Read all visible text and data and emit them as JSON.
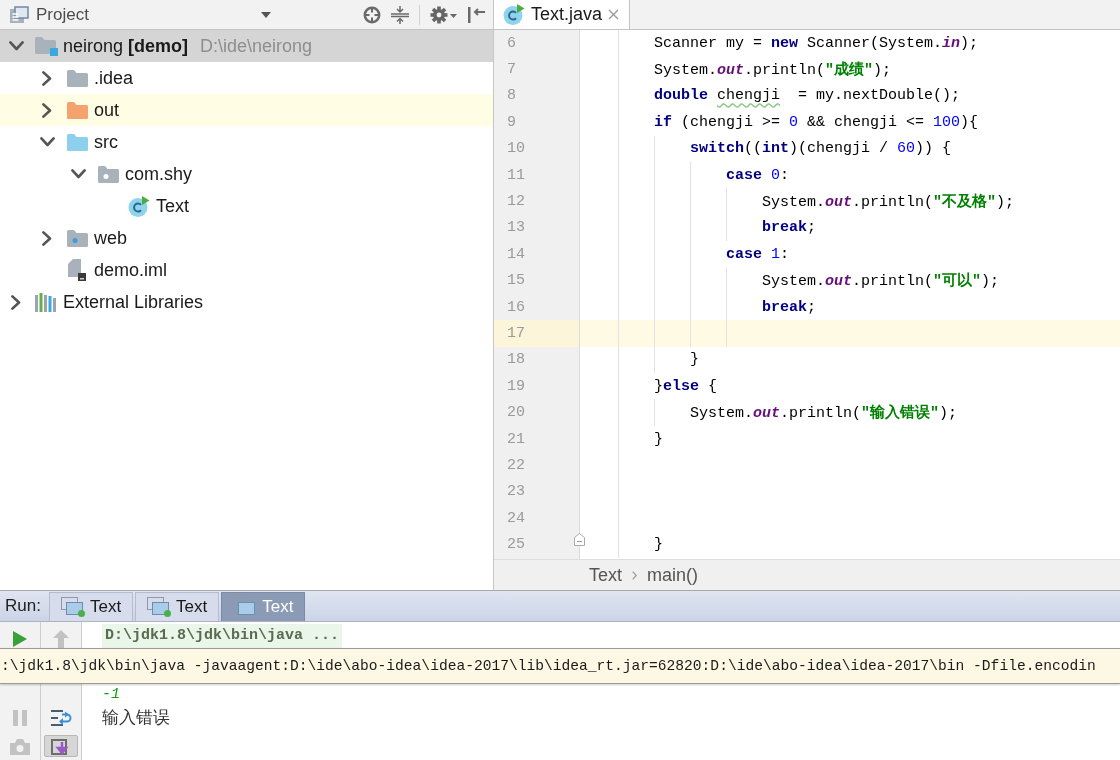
{
  "project_panel": {
    "title": "Project",
    "tree": [
      {
        "label": "neirong **[demo]**",
        "location": "D:\\ide\\neirong",
        "kind": "module",
        "expandable": true,
        "expanded": true,
        "selected": true,
        "highlighted": false,
        "children": [
          {
            "label": ".idea",
            "kind": "folder",
            "expandable": true,
            "expanded": false,
            "selected": false,
            "highlighted": false
          },
          {
            "label": "out",
            "kind": "excluded_folder",
            "expandable": true,
            "expanded": false,
            "selected": false,
            "highlighted": true
          },
          {
            "label": "src",
            "kind": "source_folder",
            "expandable": true,
            "expanded": true,
            "selected": false,
            "highlighted": false,
            "children": [
              {
                "label": "com.shy",
                "kind": "package",
                "expandable": true,
                "expanded": true,
                "selected": false,
                "highlighted": false,
                "children": [
                  {
                    "label": "Text",
                    "kind": "class",
                    "expandable": false,
                    "selected": false,
                    "highlighted": false
                  }
                ]
              }
            ]
          },
          {
            "label": "web",
            "kind": "web_folder",
            "expandable": true,
            "expanded": false,
            "selected": false,
            "highlighted": false
          },
          {
            "label": "demo.iml",
            "kind": "module_file",
            "expandable": false,
            "selected": false,
            "highlighted": false
          }
        ]
      },
      {
        "label": "External Libraries",
        "kind": "libraries",
        "expandable": true,
        "expanded": false,
        "selected": false,
        "highlighted": false
      }
    ]
  },
  "editor": {
    "tabs": [
      {
        "label": "Text.java",
        "selected": true
      }
    ],
    "lines": [
      {
        "number": "6",
        "current": false,
        "fold": false,
        "tokens": [
          {
            "kind": "plain",
            "text": "        Scanner my = "
          },
          {
            "kind": "keyword",
            "text": "new"
          },
          {
            "kind": "plain",
            "text": " Scanner(System."
          },
          {
            "kind": "field",
            "text": "in"
          },
          {
            "kind": "plain",
            "text": ");"
          }
        ]
      },
      {
        "number": "7",
        "current": false,
        "fold": false,
        "tokens": [
          {
            "kind": "plain",
            "text": "        System."
          },
          {
            "kind": "field",
            "text": "out"
          },
          {
            "kind": "plain",
            "text": ".println("
          },
          {
            "kind": "string",
            "text": "\"成绩\""
          },
          {
            "kind": "plain",
            "text": ");"
          }
        ]
      },
      {
        "number": "8",
        "current": false,
        "fold": false,
        "tokens": [
          {
            "kind": "keyword",
            "text": "        double "
          },
          {
            "kind": "typo",
            "text": "chengji"
          },
          {
            "kind": "plain",
            "text": "  = my.nextDouble();"
          }
        ]
      },
      {
        "number": "9",
        "current": false,
        "fold": false,
        "tokens": [
          {
            "kind": "keyword",
            "text": "        if"
          },
          {
            "kind": "plain",
            "text": " (chengji >= "
          },
          {
            "kind": "number",
            "text": "0"
          },
          {
            "kind": "plain",
            "text": " && chengji <= "
          },
          {
            "kind": "number",
            "text": "100"
          },
          {
            "kind": "plain",
            "text": "){"
          }
        ]
      },
      {
        "number": "10",
        "current": false,
        "fold": false,
        "tokens": [
          {
            "kind": "keyword",
            "text": "            switch"
          },
          {
            "kind": "plain",
            "text": "(("
          },
          {
            "kind": "keyword",
            "text": "int"
          },
          {
            "kind": "plain",
            "text": ")(chengji / "
          },
          {
            "kind": "number",
            "text": "60"
          },
          {
            "kind": "plain",
            "text": ")) {"
          }
        ]
      },
      {
        "number": "11",
        "current": false,
        "fold": false,
        "tokens": [
          {
            "kind": "keyword",
            "text": "                case "
          },
          {
            "kind": "number",
            "text": "0"
          },
          {
            "kind": "plain",
            "text": ":"
          }
        ]
      },
      {
        "number": "12",
        "current": false,
        "fold": false,
        "tokens": [
          {
            "kind": "plain",
            "text": "                    System."
          },
          {
            "kind": "field",
            "text": "out"
          },
          {
            "kind": "plain",
            "text": ".println("
          },
          {
            "kind": "string",
            "text": "\"不及格\""
          },
          {
            "kind": "plain",
            "text": ");"
          }
        ]
      },
      {
        "number": "13",
        "current": false,
        "fold": false,
        "tokens": [
          {
            "kind": "keyword",
            "text": "                    break"
          },
          {
            "kind": "plain",
            "text": ";"
          }
        ]
      },
      {
        "number": "14",
        "current": false,
        "fold": false,
        "tokens": [
          {
            "kind": "keyword",
            "text": "                case "
          },
          {
            "kind": "number",
            "text": "1"
          },
          {
            "kind": "plain",
            "text": ":"
          }
        ]
      },
      {
        "number": "15",
        "current": false,
        "fold": false,
        "tokens": [
          {
            "kind": "plain",
            "text": "                    System."
          },
          {
            "kind": "field",
            "text": "out"
          },
          {
            "kind": "plain",
            "text": ".println("
          },
          {
            "kind": "string",
            "text": "\"可以\""
          },
          {
            "kind": "plain",
            "text": ");"
          }
        ]
      },
      {
        "number": "16",
        "current": false,
        "fold": false,
        "tokens": [
          {
            "kind": "keyword",
            "text": "                    break"
          },
          {
            "kind": "plain",
            "text": ";"
          }
        ]
      },
      {
        "number": "17",
        "current": true,
        "fold": false
      },
      {
        "number": "18",
        "current": false,
        "fold": false,
        "tokens": [
          {
            "kind": "plain",
            "text": "            }"
          }
        ]
      },
      {
        "number": "19",
        "current": false,
        "fold": false,
        "tokens": [
          {
            "kind": "plain",
            "text": "        }"
          },
          {
            "kind": "keyword",
            "text": "else"
          },
          {
            "kind": "plain",
            "text": " {"
          }
        ]
      },
      {
        "number": "20",
        "current": false,
        "fold": false,
        "tokens": [
          {
            "kind": "plain",
            "text": "            System."
          },
          {
            "kind": "field",
            "text": "out"
          },
          {
            "kind": "plain",
            "text": ".println("
          },
          {
            "kind": "string",
            "text": "\"输入错误\""
          },
          {
            "kind": "plain",
            "text": ");"
          }
        ]
      },
      {
        "number": "21",
        "current": false,
        "fold": false,
        "tokens": [
          {
            "kind": "plain",
            "text": "        }"
          }
        ]
      },
      {
        "number": "22",
        "current": false,
        "fold": false
      },
      {
        "number": "23",
        "current": false,
        "fold": false
      },
      {
        "number": "24",
        "current": false,
        "fold": false
      },
      {
        "number": "25",
        "current": false,
        "fold": true,
        "tokens": [
          {
            "kind": "plain",
            "text": "        }"
          }
        ]
      }
    ],
    "breadcrumbs": [
      "Text",
      "main()"
    ]
  },
  "run_panel": {
    "label": "Run:",
    "tabs": [
      {
        "label": "Text",
        "running": true,
        "selected": false
      },
      {
        "label": "Text",
        "running": true,
        "selected": false
      },
      {
        "label": "Text",
        "running": false,
        "selected": true
      }
    ],
    "left_tools": [
      {
        "kind": "rerun",
        "disabled": false,
        "on": false
      },
      {
        "kind": "pause",
        "disabled": true,
        "on": false
      },
      {
        "kind": "camera",
        "disabled": true,
        "on": false
      }
    ],
    "right_tools": [
      {
        "kind": "up",
        "disabled": true,
        "on": false
      },
      {
        "kind": "soft_wrap",
        "disabled": false,
        "on": false
      },
      {
        "kind": "scroll_end",
        "disabled": false,
        "on": true
      }
    ],
    "console": {
      "command": "D:\\jdk1.8\\jdk\\bin\\java ...",
      "tooltip": ":\\jdk1.8\\jdk\\bin\\java -javaagent:D:\\ide\\abo-idea\\idea-2017\\lib\\idea_rt.jar=62820:D:\\ide\\abo-idea\\idea-2017\\bin -Dfile.encodin",
      "lines": [
        {
          "kind": "input",
          "text": "-1"
        },
        {
          "kind": "output",
          "text": "输入错误"
        }
      ]
    }
  }
}
